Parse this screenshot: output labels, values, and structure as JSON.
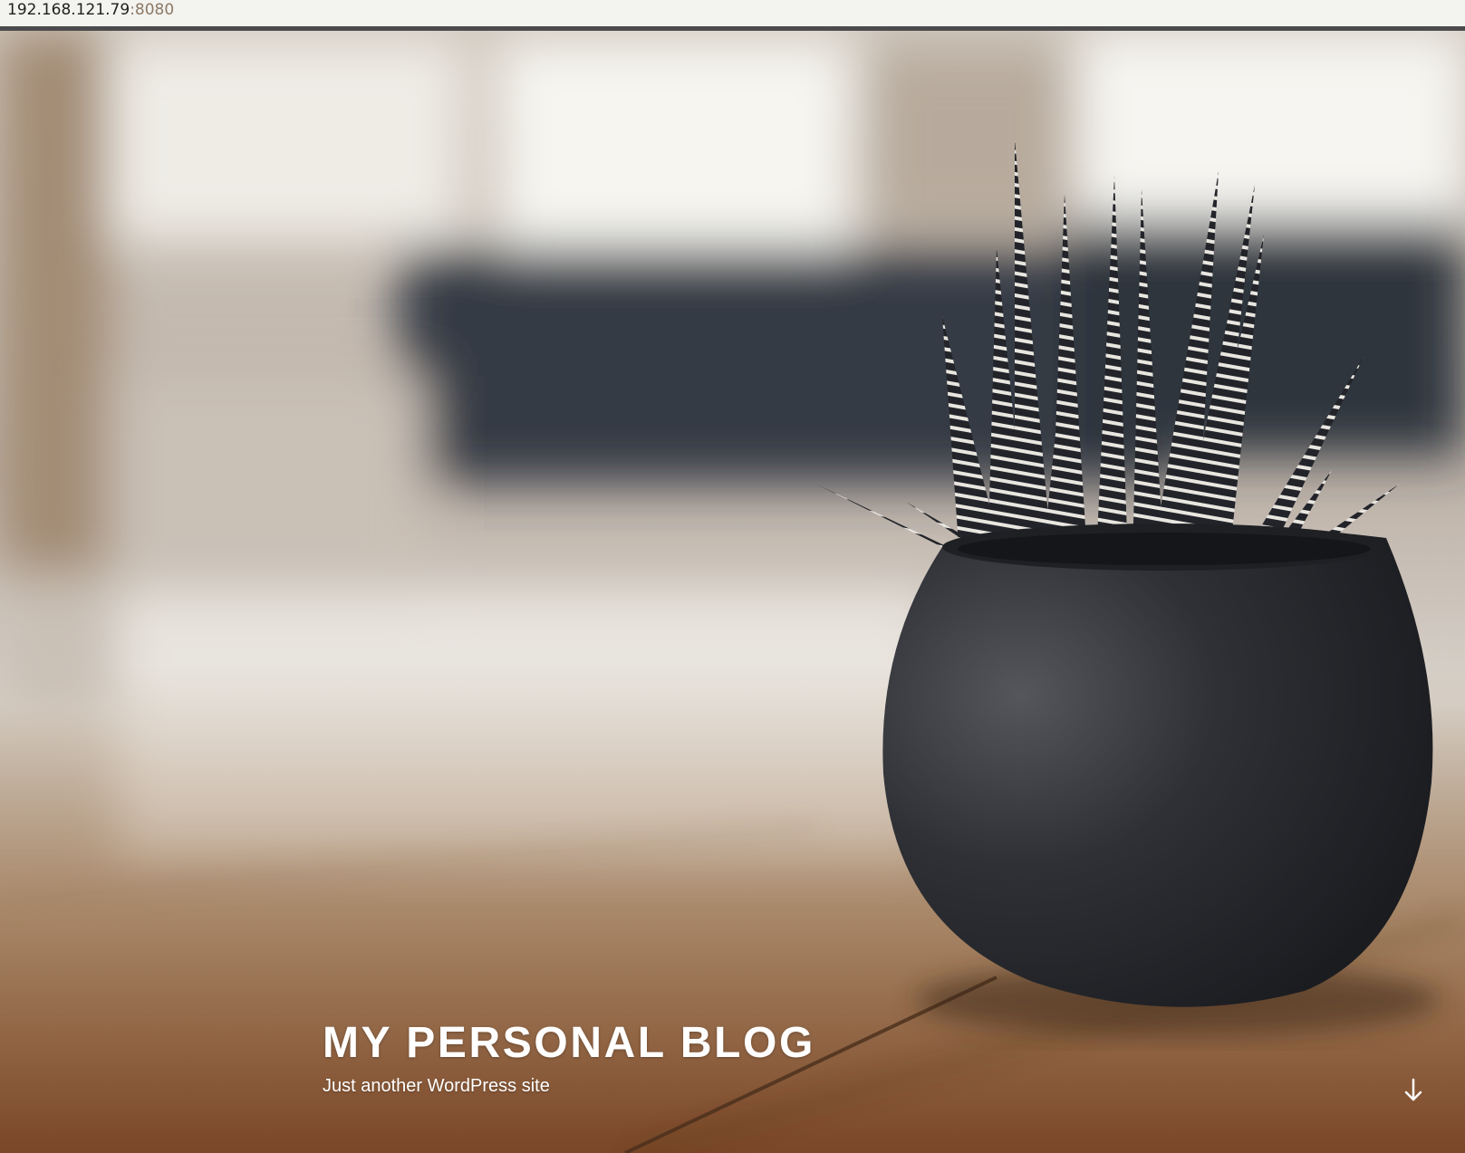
{
  "browser": {
    "address_host": "192.168.121.79",
    "address_port": ":8080"
  },
  "hero": {
    "image_subject": "potted zebra haworthia succulent on wooden table",
    "site_title": "MY PERSONAL BLOG",
    "tagline": "Just another WordPress site",
    "scroll_icon": "arrow-down-icon"
  },
  "colors": {
    "title_text": "#ffffff",
    "pot": "#25272c",
    "table_wood": "#8a5b38",
    "address_bar_bg": "#f3f3ef",
    "address_port_text": "#8c7a66"
  }
}
